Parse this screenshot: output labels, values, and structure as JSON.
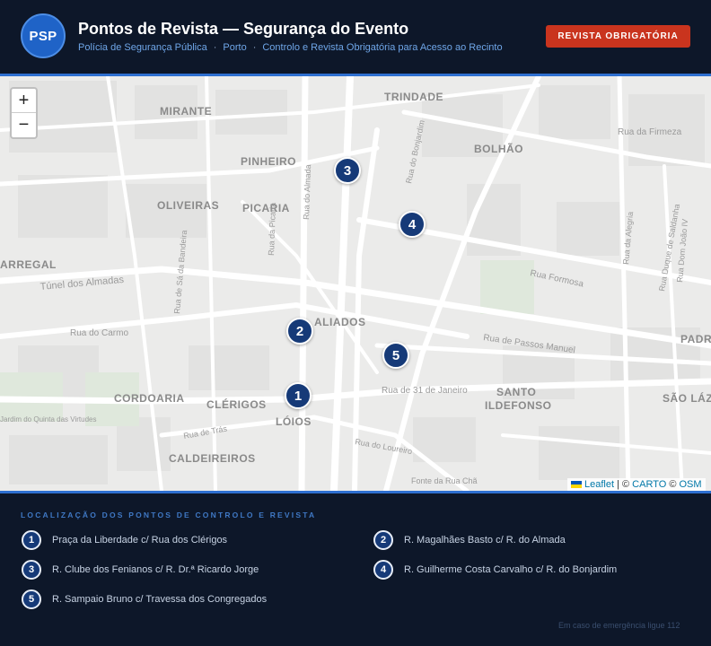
{
  "header": {
    "logo": "PSP",
    "title": "Pontos de Revista — Segurança do Evento",
    "subtitle_parts": [
      "Polícia de Segurança Pública",
      "Porto",
      "Controlo e Revista Obrigatória para Acesso ao Recinto"
    ],
    "separator": "·",
    "badge": "REVISTA OBRIGATÓRIA"
  },
  "map": {
    "zoom_in": "+",
    "zoom_out": "−",
    "attribution": {
      "leaflet": "Leaflet",
      "sep": " | © ",
      "carto": "CARTO",
      "sep2": " © ",
      "osm": "OSM"
    },
    "place_labels": [
      "MIRANTE",
      "TRINDADE",
      "PINHEIRO",
      "BOLHÃO",
      "OLIVEIRAS",
      "PICARIA",
      "ARREGAL",
      "ALIADOS",
      "PADR",
      "CORDOARIA",
      "CLÉRIGOS",
      "LÓIOS",
      "SANTO",
      "ILDEFONSO",
      "SÃO LÁZ",
      "CALDEIREIROS"
    ],
    "street_labels": [
      "Rua da Firmeza",
      "Túnel dos Almadas",
      "Rua do Carmo",
      "Rua Formosa",
      "Rua de Passos Manuel",
      "Rua de 31 de Janeiro",
      "Rua do Bonjardim",
      "Rua da Alegria",
      "Rua de Sá da Bandeira",
      "Rua da Picaria",
      "Rua do Almada",
      "Rua de Trás",
      "Rua do Loureiro",
      "Jardim do Quinta das Virtudes",
      "Fonte da Rua Chã",
      "Rua Dom João IV",
      "Rua Duque de Saldanha"
    ],
    "markers": [
      "1",
      "2",
      "3",
      "4",
      "5"
    ],
    "colors": {
      "marker": "#163a78",
      "land": "#ebebea",
      "road": "#ffffff"
    }
  },
  "legend": {
    "title": "LOCALIZAÇÃO DOS PONTOS DE CONTROLO E REVISTA",
    "items": [
      {
        "num": "1",
        "text": "Praça da Liberdade c/ Rua dos Clérigos"
      },
      {
        "num": "2",
        "text": "R. Magalhães Basto c/ R. do Almada"
      },
      {
        "num": "3",
        "text": "R. Clube dos Fenianos c/ R. Dr.ª Ricardo Jorge"
      },
      {
        "num": "4",
        "text": "R. Guilherme Costa Carvalho c/ R. do Bonjardim"
      },
      {
        "num": "5",
        "text": "R. Sampaio Bruno c/ Travessa dos Congregados"
      }
    ]
  },
  "footer": "Em caso de emergência ligue 112"
}
